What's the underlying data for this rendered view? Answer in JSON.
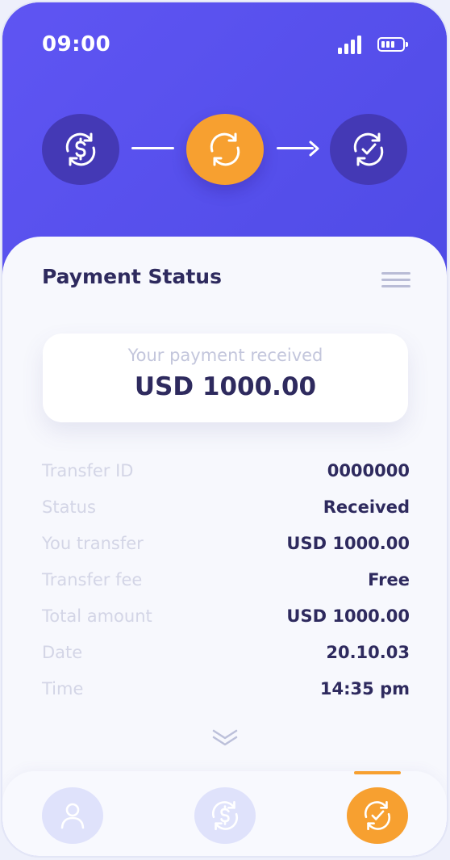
{
  "status_bar": {
    "time": "09:00",
    "signal_icon": "signal-bars-icon",
    "battery_icon": "battery-icon"
  },
  "progress_steps": [
    {
      "icon": "dollar-exchange-icon",
      "state": "done"
    },
    {
      "icon": "refresh-icon",
      "state": "active"
    },
    {
      "icon": "check-refresh-icon",
      "state": "pending"
    }
  ],
  "payment_card": {
    "title": "Payment Status",
    "menu_icon": "hamburger-menu-icon",
    "received_label": "Your payment received",
    "received_amount": "USD 1000.00"
  },
  "details": [
    {
      "label": "Transfer ID",
      "value": "0000000"
    },
    {
      "label": "Status",
      "value": "Received"
    },
    {
      "label": "You transfer",
      "value": "USD 1000.00"
    },
    {
      "label": "Transfer fee",
      "value": "Free"
    },
    {
      "label": "Total amount",
      "value": "USD 1000.00"
    },
    {
      "label": "Date",
      "value": "20.10.03"
    },
    {
      "label": "Time",
      "value": "14:35 pm"
    }
  ],
  "expand_icon": "double-chevron-down-icon",
  "bottom_nav": [
    {
      "icon": "user-icon",
      "active": false
    },
    {
      "icon": "dollar-exchange-icon",
      "active": false
    },
    {
      "icon": "check-refresh-icon",
      "active": true
    }
  ],
  "colors": {
    "header": "#5a54f0",
    "accent": "#f7a030",
    "step_dark": "#4439b5",
    "text_dark": "#2e2a5e",
    "text_muted": "#d3d5e6"
  }
}
